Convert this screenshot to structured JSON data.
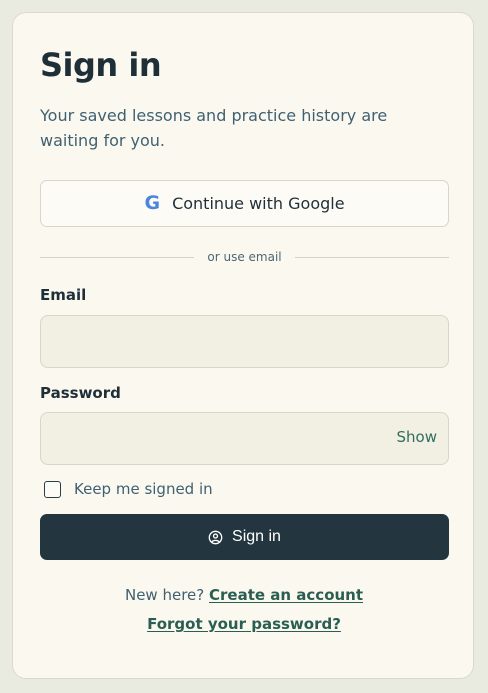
{
  "signin": {
    "title": "Sign in",
    "subtitle": "Your saved lessons and practice history are waiting for you.",
    "google": {
      "icon_glyph": "G",
      "icon_name": "google-icon",
      "label": "Continue with Google"
    },
    "divider_text": "or use email",
    "email": {
      "label": "Email",
      "value": "",
      "placeholder": ""
    },
    "password": {
      "label": "Password",
      "value": "",
      "placeholder": "",
      "toggle_label": "Show"
    },
    "keep_signed_in": {
      "label": "Keep me signed in",
      "checked": false
    },
    "submit": {
      "icon_name": "user-circle-icon",
      "label": "Sign in"
    },
    "footer": {
      "new_here_text": "New here?",
      "create_account_link": "Create an account",
      "forgot_password_link": "Forgot your password?"
    }
  },
  "colors": {
    "page_background": "#e9ebe1",
    "card_background": "#fbf8f0",
    "input_background": "#f2efe3",
    "primary_button": "#233640",
    "text_primary": "#1f2f38",
    "text_muted": "#3f6171",
    "link": "#2b5e52",
    "google_blue": "#4a86dc"
  }
}
